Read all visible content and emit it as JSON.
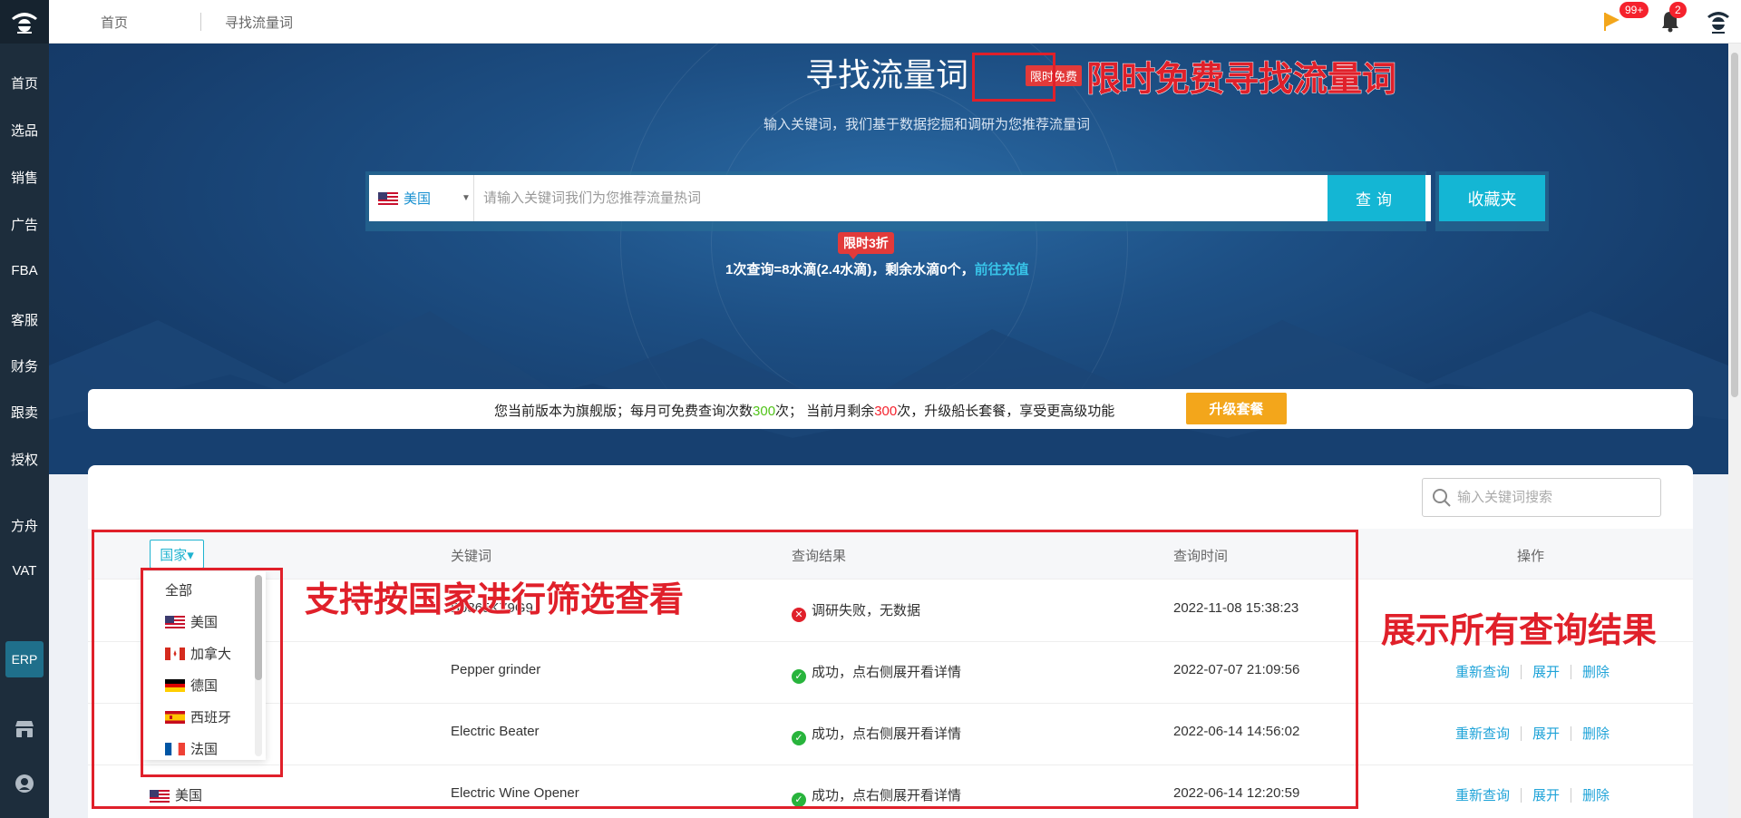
{
  "sidebar": {
    "items": [
      {
        "label": "首页"
      },
      {
        "label": "选品"
      },
      {
        "label": "销售"
      },
      {
        "label": "广告"
      },
      {
        "label": "FBA"
      },
      {
        "label": "客服"
      },
      {
        "label": "财务"
      },
      {
        "label": "跟卖"
      },
      {
        "label": "授权"
      },
      {
        "label": "方舟"
      },
      {
        "label": "VAT"
      }
    ],
    "erp_label": "ERP"
  },
  "topbar": {
    "breadcrumb_home": "首页",
    "breadcrumb_current": "寻找流量词",
    "flag_badge": "99+",
    "bell_badge": "2"
  },
  "hero": {
    "title": "寻找流量词",
    "free_tag": "限时免费",
    "subtitle": "输入关键词，我们基于数据挖掘和调研为您推荐流量词",
    "country_selected": "美国",
    "search_placeholder": "请输入关键词我们为您推荐流量热词",
    "query_label": "查询",
    "favorites_label": "收藏夹",
    "promo_tag": "限时3折",
    "cost_prefix": "1次查询=8水滴(2.4水滴)，剩余水滴",
    "cost_count": "0",
    "cost_suffix": "个，",
    "recharge_link": "前往充值"
  },
  "annotations": {
    "free_search": "限时免费寻找流量词",
    "filter_by_country": "支持按国家进行筛选查看",
    "show_all_results": "展示所有查询结果"
  },
  "plan": {
    "text_1": "您当前版本为旗舰版；每月可免费查询次数",
    "monthly_free": "300",
    "text_2": "次；  当前月剩余",
    "remaining": "300",
    "text_3": "次，升级船长套餐，享受更高级功能",
    "upgrade_label": "升级套餐"
  },
  "table": {
    "search_placeholder": "输入关键词搜索",
    "country_filter_label": "国家▾",
    "headers": {
      "keyword": "关键词",
      "result": "查询结果",
      "time": "查询时间",
      "ops": "操作"
    },
    "rows": [
      {
        "keyword": "B0865KZ9G9",
        "result": "调研失败，无数据",
        "status": "fail",
        "time": "2022-11-08 15:38:23",
        "ops": []
      },
      {
        "keyword": "Pepper grinder",
        "result": "成功，点右侧展开看详情",
        "status": "ok",
        "time": "2022-07-07 21:09:56",
        "ops": [
          "重新查询",
          "展开",
          "删除"
        ]
      },
      {
        "keyword": "Electric Beater",
        "result": "成功，点右侧展开看详情",
        "status": "ok",
        "time": "2022-06-14 14:56:02",
        "ops": [
          "重新查询",
          "展开",
          "删除"
        ]
      },
      {
        "country": "美国",
        "keyword": "Electric Wine Opener",
        "result": "成功，点右侧展开看详情",
        "status": "ok",
        "time": "2022-06-14 12:20:59",
        "ops": [
          "重新查询",
          "展开",
          "删除"
        ]
      }
    ]
  },
  "country_dropdown": {
    "options": [
      {
        "label": "全部",
        "flag": ""
      },
      {
        "label": "美国",
        "flag": "us"
      },
      {
        "label": "加拿大",
        "flag": "ca"
      },
      {
        "label": "德国",
        "flag": "de"
      },
      {
        "label": "西班牙",
        "flag": "es"
      },
      {
        "label": "法国",
        "flag": "fr"
      }
    ]
  },
  "colors": {
    "accent": "#14b6d4",
    "sidebar": "#1d2d3c",
    "annotation": "#e0202a",
    "upgrade": "#f3a61b"
  },
  "icons": {
    "logo": "pirate-logo-icon",
    "flag": "orange-flag-icon",
    "bell": "bell-icon",
    "avatar": "pirate-avatar-icon",
    "search": "search-icon"
  }
}
